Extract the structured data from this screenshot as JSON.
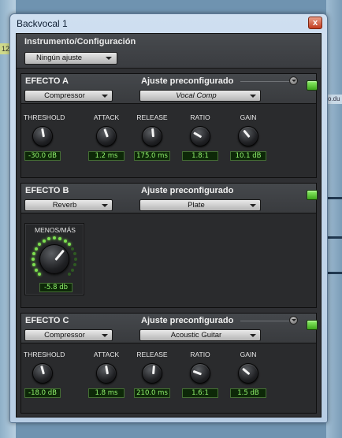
{
  "background": {
    "left_tag": "12",
    "right_tag": "o.du"
  },
  "window": {
    "title": "Backvocal 1",
    "close_glyph": "x"
  },
  "header": {
    "title": "Instrumento/Configuración",
    "preset_value": "Ningún ajuste"
  },
  "effects": [
    {
      "title": "EFECTO A",
      "preset_label": "Ajuste preconfigurado",
      "type": "Compressor",
      "preset": "Vocal Comp",
      "enabled": true,
      "knobs": [
        {
          "label": "THRESHOLD",
          "value": "-30.0 dB"
        },
        {
          "label": "ATTACK",
          "value": "1.2 ms"
        },
        {
          "label": "RELEASE",
          "value": "175.0 ms"
        },
        {
          "label": "RATIO",
          "value": "1.8:1"
        },
        {
          "label": "GAIN",
          "value": "10.1 dB"
        }
      ]
    },
    {
      "title": "EFECTO B",
      "preset_label": "Ajuste preconfigurado",
      "type": "Reverb",
      "preset": "Plate",
      "enabled": true,
      "knob": {
        "label": "MENOS/MÁS",
        "value": "-5.8 db"
      }
    },
    {
      "title": "EFECTO C",
      "preset_label": "Ajuste preconfigurado",
      "type": "Compressor",
      "preset": "Acoustic Guitar",
      "enabled": true,
      "knobs": [
        {
          "label": "THRESHOLD",
          "value": "-18.0 dB"
        },
        {
          "label": "ATTACK",
          "value": "1.8 ms"
        },
        {
          "label": "RELEASE",
          "value": "210.0 ms"
        },
        {
          "label": "RATIO",
          "value": "1.6:1"
        },
        {
          "label": "GAIN",
          "value": "1.5 dB"
        }
      ]
    }
  ],
  "colors": {
    "led_on": "#7de04f",
    "led_off": "#2f5a22",
    "value_text": "#92f56e",
    "panel_bg": "#2a2b2d"
  }
}
